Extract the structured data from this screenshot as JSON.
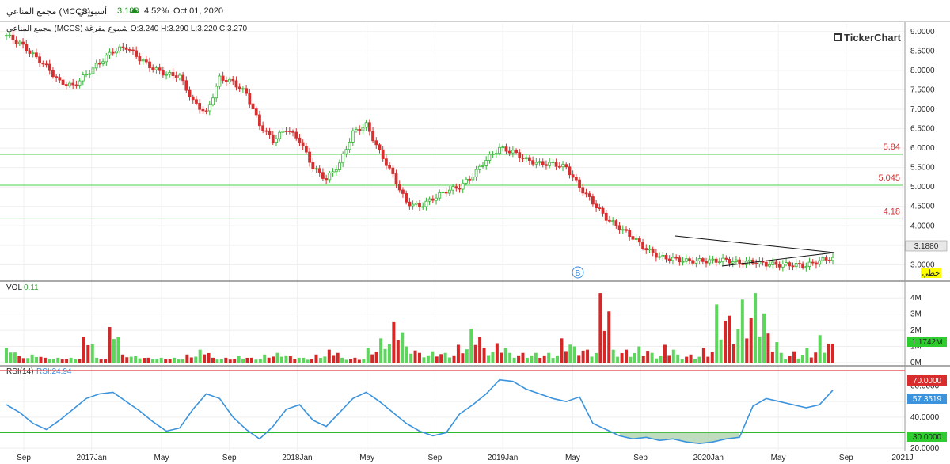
{
  "header": {
    "name": "مجمع المناعي (MCCS)",
    "period": "أسبوعي",
    "price": "3.188",
    "change_pct": "4.52%",
    "date": "Oct 01, 2020"
  },
  "price_panel": {
    "info": "مجمع المناعي (MCCS)  شموع مفرغة  O:3.240  H:3.290  L:3.220  C:3.270",
    "watermark": "TickerChart",
    "last_price_label": "3.1880",
    "style_badge": "خطي",
    "marker_b": "B",
    "yticks": [
      "9.0000",
      "8.5000",
      "8.0000",
      "7.5000",
      "7.0000",
      "6.5000",
      "6.0000",
      "5.5000",
      "5.0000",
      "4.5000",
      "4.0000",
      "3.5000",
      "3.0000"
    ],
    "levels": [
      {
        "value": 5.84,
        "label": "5.84"
      },
      {
        "value": 5.045,
        "label": "5.045"
      },
      {
        "value": 4.18,
        "label": "4.18"
      }
    ]
  },
  "volume_panel": {
    "title": "VOL",
    "value": "0.11",
    "yticks": [
      "4M",
      "3M",
      "2M",
      "1M",
      "0M"
    ],
    "last_label": "1.1742M"
  },
  "rsi_panel": {
    "title": "RSI(14)",
    "value": "RSI:24.94",
    "yticks": [
      "60.0000",
      "50.0000",
      "40.0000",
      "20.0000"
    ],
    "upper_label": "70.0000",
    "lower_label": "30.0000",
    "last_label": "57.3519"
  },
  "xaxis": {
    "labels": [
      {
        "text": "Sep",
        "pos": 0.0
      },
      {
        "text": "2017Jan",
        "pos": 0.33
      },
      {
        "text": "May",
        "pos": 0.67
      },
      {
        "text": "Sep",
        "pos": 1.0
      },
      {
        "text": "2018Jan",
        "pos": 1.33
      },
      {
        "text": "May",
        "pos": 1.67
      },
      {
        "text": "Sep",
        "pos": 2.0
      },
      {
        "text": "2019Jan",
        "pos": 2.33
      },
      {
        "text": "May",
        "pos": 2.67
      },
      {
        "text": "Sep",
        "pos": 3.0
      },
      {
        "text": "2020Jan",
        "pos": 3.33
      },
      {
        "text": "May",
        "pos": 3.67
      },
      {
        "text": "Sep",
        "pos": 4.0
      },
      {
        "text": "2021J",
        "pos": 4.33
      }
    ]
  },
  "chart_data": [
    {
      "type": "line",
      "title": "",
      "series": [
        {
          "values": [
            8.9,
            8.7,
            8.4,
            8.1,
            7.7,
            7.6,
            7.9,
            8.2,
            8.5,
            8.6,
            8.3,
            8.05,
            7.9,
            7.85,
            7.2,
            6.9,
            7.8,
            7.7,
            7.4,
            6.6,
            6.2,
            6.5,
            6.2,
            5.5,
            5.2,
            5.6,
            6.4,
            6.6,
            5.9,
            5.3,
            4.6,
            4.5,
            4.7,
            4.9,
            5.0,
            5.3,
            5.7,
            6.0,
            5.9,
            5.7,
            5.6,
            5.6,
            5.5,
            5.0,
            4.6,
            4.2,
            3.95,
            3.7,
            3.4,
            3.2,
            3.15,
            3.1,
            3.1,
            3.1,
            3.12,
            3.05,
            3.08,
            3.02,
            3.0,
            3.0,
            2.98,
            3.1,
            3.188
          ]
        }
      ],
      "ylim": [
        2.6,
        9.2
      ]
    },
    {
      "type": "bar",
      "title": "",
      "series": [
        {
          "values": [
            0.9,
            0.4,
            0.5,
            0.3,
            0.3,
            0.3,
            1.6,
            0.3,
            2.2,
            0.5,
            0.4,
            0.3,
            0.3,
            0.3,
            0.5,
            0.8,
            0.3,
            0.3,
            0.4,
            0.3,
            0.5,
            0.6,
            0.4,
            0.3,
            0.5,
            0.8,
            0.3,
            0.3,
            0.9,
            1.5,
            2.5,
            1.0,
            0.6,
            0.7,
            0.6,
            1.1,
            2.1,
            0.9,
            1.2,
            0.6,
            0.6,
            0.6,
            0.6,
            1.5,
            1.0,
            0.8,
            4.3,
            0.8,
            0.8,
            1.0,
            0.6,
            1.1,
            0.5,
            0.5,
            0.9,
            3.6,
            2.9,
            3.9,
            4.3,
            1.8,
            0.6,
            0.7,
            0.9,
            1.7,
            1.1742
          ]
        }
      ],
      "ylim": [
        0,
        4.5
      ]
    },
    {
      "type": "line",
      "title": "",
      "series": [
        {
          "values": [
            48,
            43,
            36,
            32,
            38,
            45,
            52,
            55,
            56,
            50,
            44,
            37,
            31,
            33,
            45,
            55,
            52,
            40,
            32,
            26,
            34,
            45,
            48,
            38,
            34,
            43,
            52,
            56,
            50,
            43,
            36,
            31,
            28,
            30,
            42,
            48,
            55,
            64,
            63,
            58,
            55,
            52,
            50,
            53,
            36,
            32,
            28,
            26,
            27,
            25,
            26,
            24,
            23,
            24,
            26,
            27,
            47,
            52,
            50,
            48,
            46,
            48,
            57.35
          ]
        }
      ],
      "ylim": [
        18,
        72
      ]
    }
  ]
}
